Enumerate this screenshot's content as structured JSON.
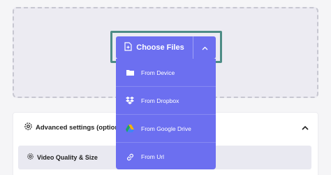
{
  "upload": {
    "choose_label": "Choose Files",
    "menu": [
      {
        "label": "From Device",
        "icon": "folder-icon"
      },
      {
        "label": "From Dropbox",
        "icon": "dropbox-icon"
      },
      {
        "label": "From Google Drive",
        "icon": "google-drive-icon"
      },
      {
        "label": "From Url",
        "icon": "link-icon"
      }
    ]
  },
  "settings": {
    "advanced_label": "Advanced settings (optional)",
    "video_quality_label": "Video Quality & Size"
  },
  "colors": {
    "accent": "#6c6ff0",
    "focus_ring": "#4d8c86"
  }
}
